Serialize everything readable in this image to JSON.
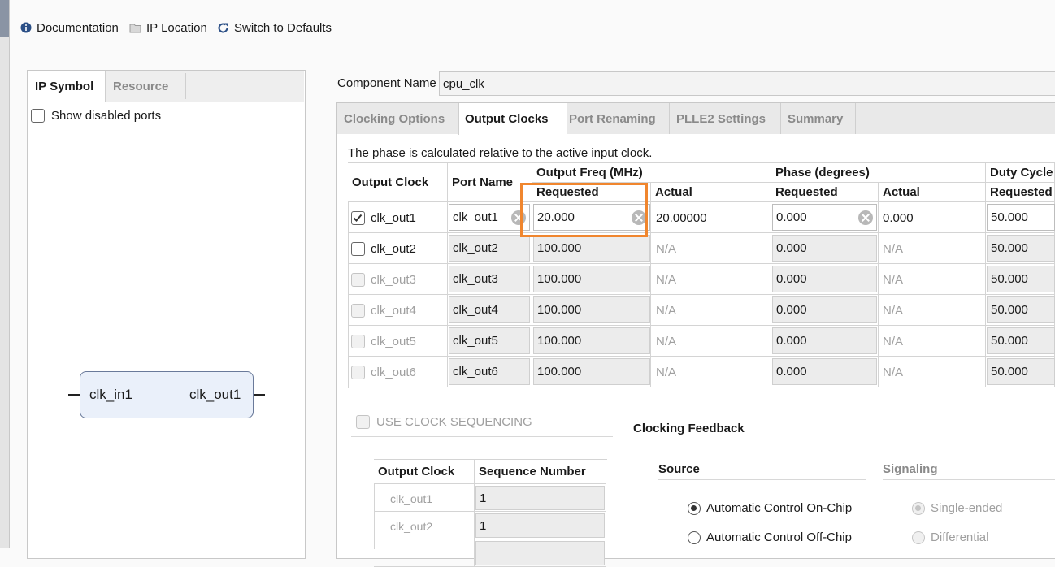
{
  "toolbar": {
    "documentation": "Documentation",
    "ip_location": "IP Location",
    "switch_defaults": "Switch to Defaults"
  },
  "left_panel": {
    "tabs": [
      "IP Symbol",
      "Resource"
    ],
    "show_disabled_ports": "Show disabled ports",
    "symbol": {
      "input_port": "clk_in1",
      "output_port": "clk_out1"
    }
  },
  "component": {
    "label": "Component Name",
    "value": "cpu_clk"
  },
  "tabs": [
    "Clocking Options",
    "Output Clocks",
    "Port Renaming",
    "PLLE2 Settings",
    "Summary"
  ],
  "active_tab": "Output Clocks",
  "note": "The phase is calculated relative to the active input clock.",
  "table": {
    "headers": {
      "output_clock": "Output Clock",
      "port_name": "Port Name",
      "output_freq": "Output Freq (MHz)",
      "phase": "Phase (degrees)",
      "duty_cycle": "Duty Cycle (",
      "requested": "Requested",
      "actual": "Actual"
    },
    "rows": [
      {
        "name": "clk_out1",
        "checked": true,
        "enabled": true,
        "port": "clk_out1",
        "freq_req": "20.000",
        "freq_act": "20.00000",
        "phase_req": "0.000",
        "phase_act": "0.000",
        "duty_req": "50.000"
      },
      {
        "name": "clk_out2",
        "checked": false,
        "enabled": true,
        "port": "clk_out2",
        "freq_req": "100.000",
        "freq_act": "N/A",
        "phase_req": "0.000",
        "phase_act": "N/A",
        "duty_req": "50.000"
      },
      {
        "name": "clk_out3",
        "checked": false,
        "enabled": false,
        "port": "clk_out3",
        "freq_req": "100.000",
        "freq_act": "N/A",
        "phase_req": "0.000",
        "phase_act": "N/A",
        "duty_req": "50.000"
      },
      {
        "name": "clk_out4",
        "checked": false,
        "enabled": false,
        "port": "clk_out4",
        "freq_req": "100.000",
        "freq_act": "N/A",
        "phase_req": "0.000",
        "phase_act": "N/A",
        "duty_req": "50.000"
      },
      {
        "name": "clk_out5",
        "checked": false,
        "enabled": false,
        "port": "clk_out5",
        "freq_req": "100.000",
        "freq_act": "N/A",
        "phase_req": "0.000",
        "phase_act": "N/A",
        "duty_req": "50.000"
      },
      {
        "name": "clk_out6",
        "checked": false,
        "enabled": false,
        "port": "clk_out6",
        "freq_req": "100.000",
        "freq_act": "N/A",
        "phase_req": "0.000",
        "phase_act": "N/A",
        "duty_req": "50.000"
      }
    ]
  },
  "sequencing": {
    "label": "USE CLOCK SEQUENCING",
    "headers": [
      "Output Clock",
      "Sequence Number"
    ],
    "rows": [
      {
        "clock": "clk_out1",
        "seq": "1"
      },
      {
        "clock": "clk_out2",
        "seq": "1"
      }
    ]
  },
  "feedback": {
    "title": "Clocking Feedback",
    "source_label": "Source",
    "signaling_label": "Signaling",
    "source_options": [
      "Automatic Control On-Chip",
      "Automatic Control Off-Chip"
    ],
    "signaling_options": [
      "Single-ended",
      "Differential"
    ]
  },
  "colors": {
    "highlight": "#f0862e"
  }
}
